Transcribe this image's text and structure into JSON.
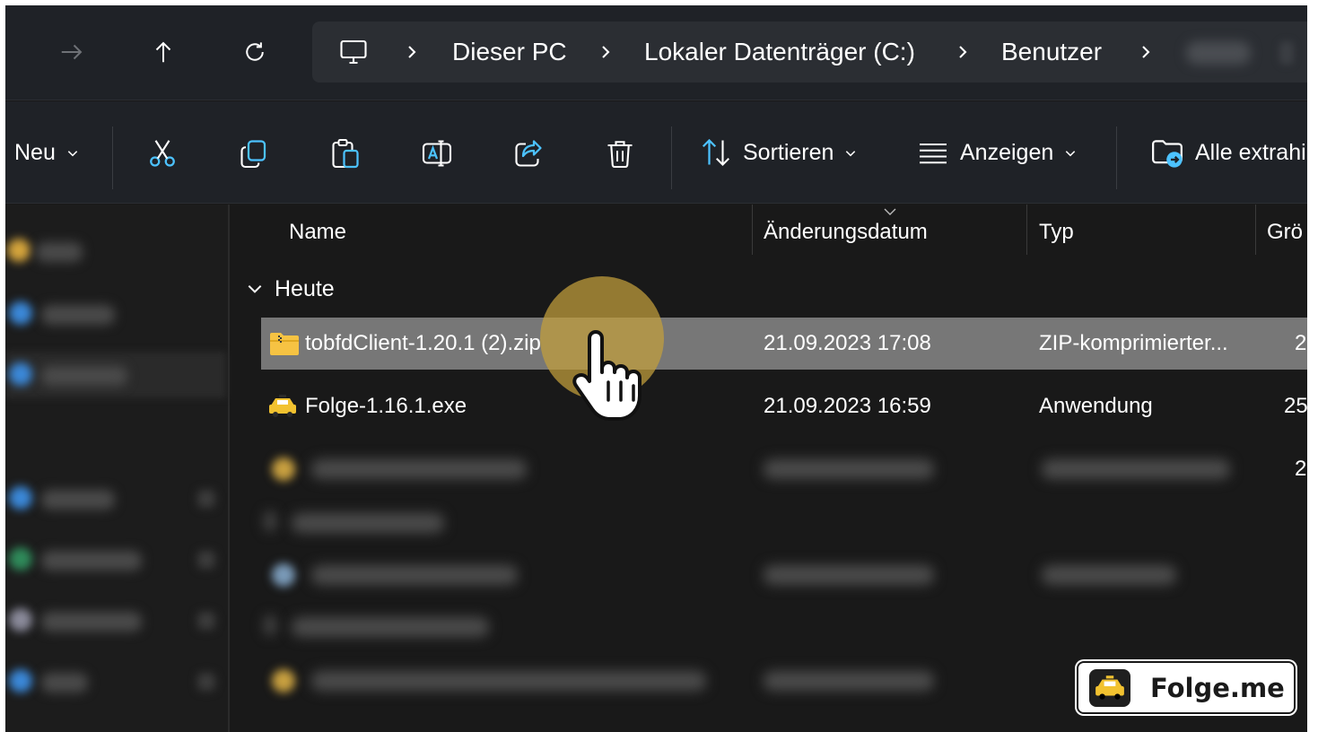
{
  "address_bar": {
    "crumbs": [
      "Dieser PC",
      "Lokaler Datenträger (C:)",
      "Benutzer"
    ]
  },
  "command_bar": {
    "new_label": "Neu",
    "sort_label": "Sortieren",
    "view_label": "Anzeigen",
    "extract_label": "Alle extrahi"
  },
  "columns": {
    "name": "Name",
    "date": "Änderungsdatum",
    "type": "Typ",
    "size": "Grö"
  },
  "group": {
    "label": "Heute"
  },
  "files": [
    {
      "name": "tobfdClient-1.20.1 (2).zip",
      "date": "21.09.2023 17:08",
      "type": "ZIP-komprimierter...",
      "size": "2",
      "icon": "zip-folder-icon",
      "selected": true
    },
    {
      "name": "Folge-1.16.1.exe",
      "date": "21.09.2023 16:59",
      "type": "Anwendung",
      "size": "25",
      "icon": "folge-app-icon",
      "selected": false
    }
  ],
  "blurred_row_size": "2",
  "watermark": {
    "text": "Folge.me"
  },
  "colors": {
    "background": "#191919",
    "toolbar": "#1f2227",
    "selection": "#777777",
    "accent_blue": "#4cc2ff",
    "folder_yellow": "#f6c343",
    "highlight": "#c4a03c"
  }
}
